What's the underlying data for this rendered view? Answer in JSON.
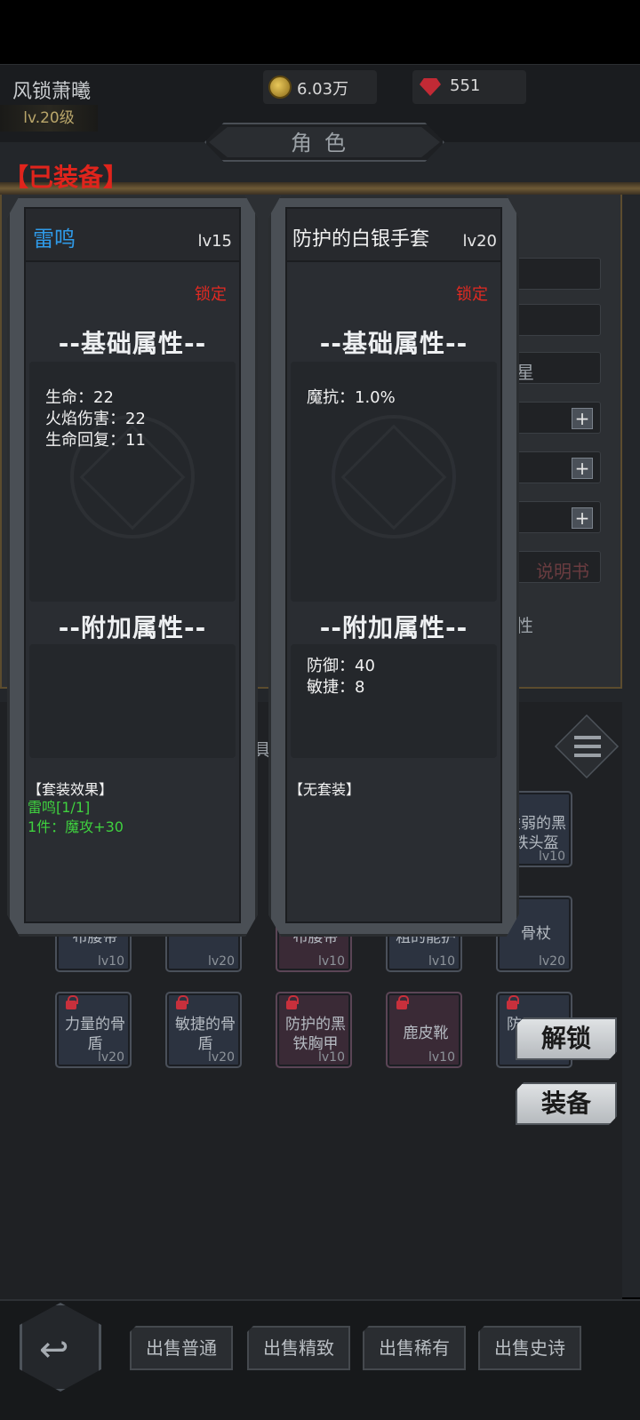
{
  "player": {
    "name": "风锁萧曦",
    "level": "lv.20级"
  },
  "currency": {
    "gold": "6.03万",
    "gems": "551"
  },
  "screen_title": "角色",
  "equipped_label": "【已装备】",
  "side_words": {
    "star": "星",
    "manual": "说明书",
    "attr": "性",
    "hidden_tab": "具"
  },
  "items": [
    {
      "name": "布腰带",
      "level": "lv10",
      "style": "blue"
    },
    {
      "name": "",
      "level": "lv20",
      "style": "blue"
    },
    {
      "name": "布腰带",
      "level": "lv10",
      "style": "purple"
    },
    {
      "name": "粗的能护",
      "level": "lv10",
      "style": "blue"
    },
    {
      "name": "骨杖",
      "level": "lv20",
      "style": "blue"
    },
    {
      "name": "力量的骨盾",
      "level": "lv20",
      "style": "blue"
    },
    {
      "name": "敏捷的骨盾",
      "level": "lv20",
      "style": "blue"
    },
    {
      "name": "防护的黑铁胸甲",
      "level": "lv10",
      "style": "purple"
    },
    {
      "name": "鹿皮靴",
      "level": "lv10",
      "style": "purple"
    },
    {
      "name": "防",
      "level": "",
      "style": "blue"
    },
    {
      "name": "虚弱的黑铁头盔",
      "level": "lv10",
      "style": "blue"
    }
  ],
  "actions": {
    "unlock": "解锁",
    "equip": "装备"
  },
  "sell_buttons": [
    "出售普通",
    "出售精致",
    "出售稀有",
    "出售史诗"
  ],
  "left_card": {
    "name": "雷鸣",
    "name_color": "#2f9ae8",
    "level": "lv15",
    "lock": "锁定",
    "base_title": "--基础属性--",
    "base_stats": [
      "生命：22",
      "火焰伤害：22",
      "生命回复：11"
    ],
    "extra_title": "--附加属性--",
    "extra_stats": [],
    "set_title": "【套装效果】",
    "set_name": "雷鸣[1/1]",
    "set_bonus": "1件：魔攻+30"
  },
  "right_card": {
    "name": "防护的白银手套",
    "name_color": "#f2f2f2",
    "level": "lv20",
    "lock": "锁定",
    "base_title": "--基础属性--",
    "base_stats": [
      "魔抗：1.0%"
    ],
    "extra_title": "--附加属性--",
    "extra_stats": [
      "防御：40",
      "敏捷：8"
    ],
    "set_title": "【无套装】"
  },
  "colors": {
    "lock_red": "#e22a22",
    "set_green": "#3fd13f",
    "equipped_red": "#e0241c"
  }
}
